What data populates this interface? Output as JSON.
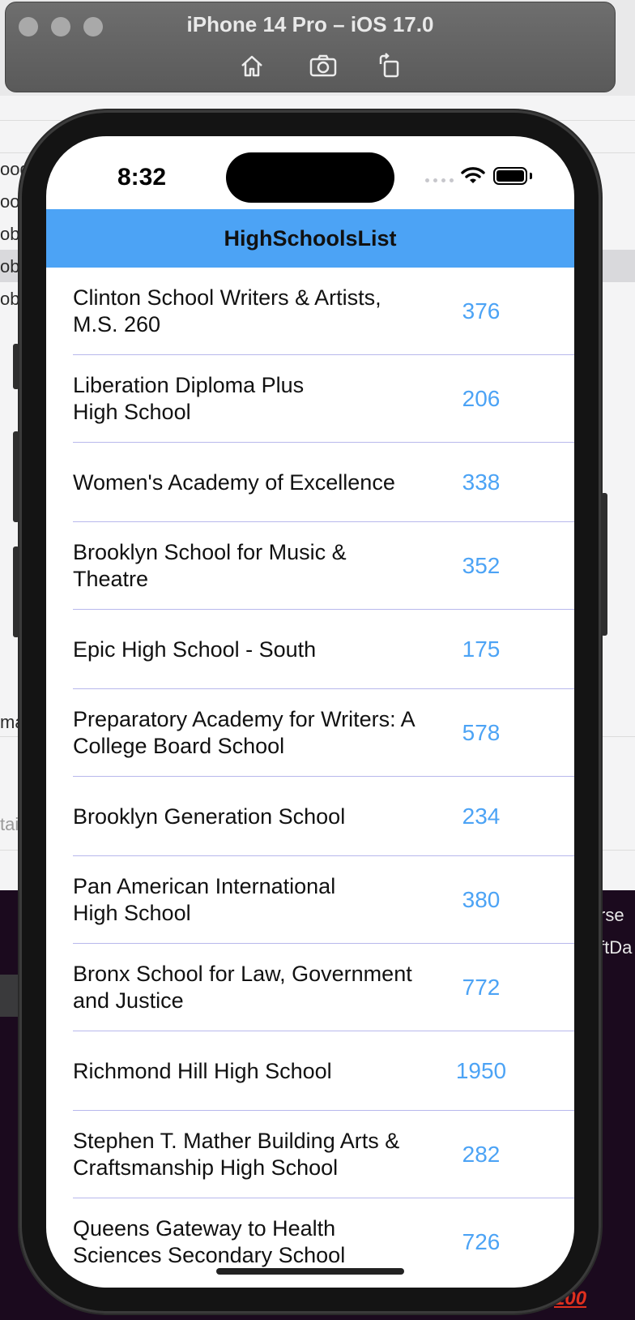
{
  "simulator": {
    "title": "iPhone 14 Pro – iOS 17.0",
    "buttons": [
      "home-icon",
      "screenshot-icon",
      "rotate-icon"
    ]
  },
  "background_fragments": [
    "ood",
    "ood",
    "obj",
    "ob",
    "obe",
    "ma",
    "tai",
    "rse",
    "ftDa"
  ],
  "status_bar": {
    "time": "8:32"
  },
  "nav": {
    "title": "HighSchoolsList"
  },
  "schools": [
    {
      "name": "Clinton School Writers & Artists, M.S. 260",
      "count": "376"
    },
    {
      "name": "Liberation Diploma Plus High School",
      "count": "206"
    },
    {
      "name": "Women's Academy of Excellence",
      "count": "338"
    },
    {
      "name": "Brooklyn School for Music & Theatre",
      "count": "352"
    },
    {
      "name": "Epic High School - South",
      "count": "175"
    },
    {
      "name": "Preparatory Academy for Writers: A College Board School",
      "count": "578"
    },
    {
      "name": "Brooklyn Generation School",
      "count": "234"
    },
    {
      "name": "Pan American International High School",
      "count": "380"
    },
    {
      "name": "Bronx School for Law, Government and Justice",
      "count": "772"
    },
    {
      "name": "Richmond Hill High School",
      "count": "1950"
    },
    {
      "name": "Stephen T. Mather Building Arts & Craftsmanship High School",
      "count": "282"
    },
    {
      "name": "Queens Gateway to Health Sciences Secondary School",
      "count": "726"
    }
  ],
  "colors": {
    "accent": "#4ca3f5",
    "divider": "#b8b8ec"
  }
}
